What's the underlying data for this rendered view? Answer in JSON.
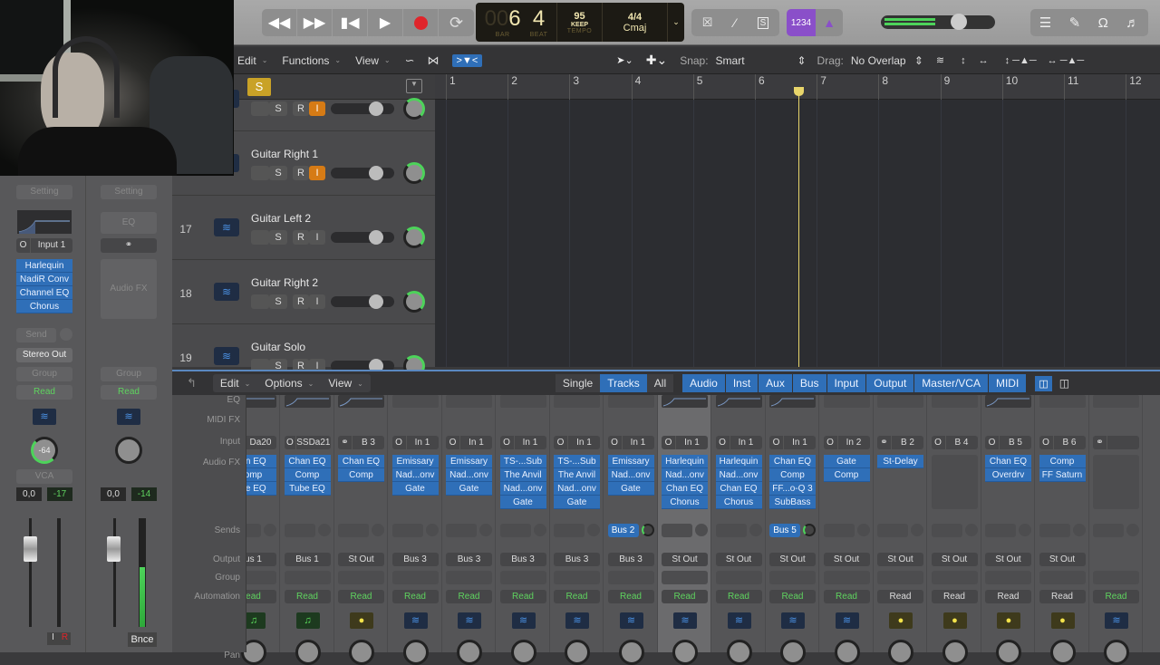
{
  "transport": {
    "buttons": [
      "rewind",
      "fast-forward",
      "go-to-start",
      "play",
      "record",
      "cycle"
    ],
    "bar_dim": "00",
    "bar": "6",
    "beat": "4",
    "bar_label": "BAR",
    "beat_label": "BEAT",
    "tempo": "95",
    "tempo_mode": "KEEP",
    "tempo_label": "TEMPO",
    "signature": "4/4",
    "key": "Cmaj",
    "count_in": "1234"
  },
  "colors": {
    "accent_blue": "#2f6fb8",
    "record_red": "#e0252b",
    "input_orange": "#d67b15",
    "read_green": "#5fd35f",
    "count_in_purple": "#8a4fc9",
    "solo_yellow": "#c9a227"
  },
  "arrange_toolbar": {
    "edit": "Edit",
    "functions": "Functions",
    "view": "View",
    "snap_label": "Snap:",
    "snap_value": "Smart",
    "drag_label": "Drag:",
    "drag_value": "No Overlap"
  },
  "ruler": {
    "bars": [
      "1",
      "2",
      "3",
      "4",
      "5",
      "6",
      "7",
      "8",
      "9",
      "10",
      "11",
      "12"
    ],
    "playhead_bar": 6.7
  },
  "tracks": [
    {
      "number": "",
      "name": "",
      "solo": "S",
      "rec": "R",
      "input": "I",
      "input_on": true
    },
    {
      "number": "",
      "name": "Guitar Right 1",
      "solo": "S",
      "rec": "R",
      "input": "I",
      "input_on": true
    },
    {
      "number": "17",
      "name": "Guitar Left 2",
      "solo": "S",
      "rec": "R",
      "input": "I",
      "input_on": false
    },
    {
      "number": "18",
      "name": "Guitar Right 2",
      "solo": "S",
      "rec": "R",
      "input": "I",
      "input_on": false
    },
    {
      "number": "19",
      "name": "Guitar Solo",
      "solo": "S",
      "rec": "R",
      "input": "I",
      "input_on": false
    }
  ],
  "global_solo": "S",
  "inspector": {
    "left": {
      "setting": "Setting",
      "input": "Input 1",
      "plugins": [
        "Harlequin",
        "NadiR Conv",
        "Channel EQ",
        "Chorus"
      ],
      "send": "Send",
      "output": "Stereo Out",
      "group": "Group",
      "automation": "Read",
      "pan": "-64",
      "vca": "VCA",
      "volume": "0,0",
      "peak": "-17",
      "input_btn": "I",
      "rec_btn": "R"
    },
    "right": {
      "setting": "Setting",
      "eq": "EQ",
      "audio_fx": "Audio FX",
      "group": "Group",
      "automation": "Read",
      "volume": "0,0",
      "peak": "-14",
      "bounce": "Bnce"
    }
  },
  "mixer_toolbar": {
    "edit": "Edit",
    "options": "Options",
    "view": "View",
    "view_tabs": [
      "Single",
      "Tracks",
      "All"
    ],
    "selected_view": "Tracks",
    "filters": [
      "Audio",
      "Inst",
      "Aux",
      "Bus",
      "Input",
      "Output",
      "Master/VCA",
      "MIDI"
    ]
  },
  "mixer_labels": [
    "EQ",
    "MIDI FX",
    "Input",
    "Audio FX",
    "Sends",
    "Output",
    "Group",
    "Automation",
    "Pan"
  ],
  "channels": [
    {
      "input": "Da20",
      "plugins": [
        "an EQ",
        "omp",
        "be EQ"
      ],
      "send": "",
      "output": "us 1",
      "automation": "ead",
      "read_green": true,
      "type": "inst",
      "eq": true
    },
    {
      "input": "SSDa21",
      "plugins": [
        "Chan EQ",
        "Comp",
        "Tube EQ"
      ],
      "send": "",
      "output": "Bus 1",
      "automation": "Read",
      "read_green": true,
      "type": "inst",
      "eq": true
    },
    {
      "input": "B 3",
      "plugins": [
        "Chan EQ",
        "Comp"
      ],
      "send": "",
      "output": "St Out",
      "automation": "Read",
      "read_green": true,
      "type": "aux",
      "eq": true
    },
    {
      "input": "In 1",
      "plugins": [
        "Emissary",
        "Nad...onv",
        "Gate"
      ],
      "send": "",
      "output": "Bus 3",
      "automation": "Read",
      "read_green": true,
      "type": "audio",
      "eq": false
    },
    {
      "input": "In 1",
      "plugins": [
        "Emissary",
        "Nad...onv",
        "Gate"
      ],
      "send": "",
      "output": "Bus 3",
      "automation": "Read",
      "read_green": true,
      "type": "audio",
      "eq": false
    },
    {
      "input": "In 1",
      "plugins": [
        "TS-...Sub",
        "The Anvil",
        "Nad...onv",
        "Gate"
      ],
      "send": "",
      "output": "Bus 3",
      "automation": "Read",
      "read_green": true,
      "type": "audio",
      "eq": false
    },
    {
      "input": "In 1",
      "plugins": [
        "TS-...Sub",
        "The Anvil",
        "Nad...onv",
        "Gate"
      ],
      "send": "",
      "output": "Bus 3",
      "automation": "Read",
      "read_green": true,
      "type": "audio",
      "eq": false
    },
    {
      "input": "In 1",
      "plugins": [
        "Emissary",
        "Nad...onv",
        "Gate"
      ],
      "send": "Bus 2",
      "output": "Bus 3",
      "automation": "Read",
      "read_green": true,
      "type": "audio",
      "eq": false
    },
    {
      "input": "In 1",
      "plugins": [
        "Harlequin",
        "Nad...onv",
        "Chan EQ",
        "Chorus"
      ],
      "send": "",
      "output": "St Out",
      "automation": "Read",
      "read_green": true,
      "type": "audio",
      "eq": true,
      "selected": true
    },
    {
      "input": "In 1",
      "plugins": [
        "Harlequin",
        "Nad...onv",
        "Chan EQ",
        "Chorus"
      ],
      "send": "",
      "output": "St Out",
      "automation": "Read",
      "read_green": true,
      "type": "audio",
      "eq": true
    },
    {
      "input": "In 1",
      "plugins": [
        "Chan EQ",
        "Comp",
        "FF...o-Q 3",
        "SubBass"
      ],
      "send": "Bus 5",
      "output": "St Out",
      "automation": "Read",
      "read_green": true,
      "type": "audio",
      "eq": true
    },
    {
      "input": "In 2",
      "plugins": [
        "Gate",
        "Comp"
      ],
      "send": "",
      "output": "St Out",
      "automation": "Read",
      "read_green": true,
      "type": "audio",
      "eq": false
    },
    {
      "input": "B 2",
      "plugins": [
        "St-Delay"
      ],
      "send": "",
      "output": "St Out",
      "automation": "Read",
      "read_green": false,
      "type": "aux",
      "eq": false
    },
    {
      "input": "B 4",
      "plugins": [],
      "send": "",
      "output": "St Out",
      "automation": "Read",
      "read_green": false,
      "type": "aux",
      "eq": false
    },
    {
      "input": "B 5",
      "plugins": [
        "Chan EQ",
        "Overdrv"
      ],
      "send": "",
      "output": "St Out",
      "automation": "Read",
      "read_green": false,
      "type": "aux",
      "eq": true
    },
    {
      "input": "B 6",
      "plugins": [
        "Comp",
        "FF Saturn"
      ],
      "send": "",
      "output": "St Out",
      "automation": "Read",
      "read_green": false,
      "type": "aux",
      "eq": false
    },
    {
      "input": "",
      "plugins": [],
      "send": "",
      "output": "",
      "automation": "Read",
      "read_green": true,
      "type": "audio",
      "eq": false
    }
  ]
}
